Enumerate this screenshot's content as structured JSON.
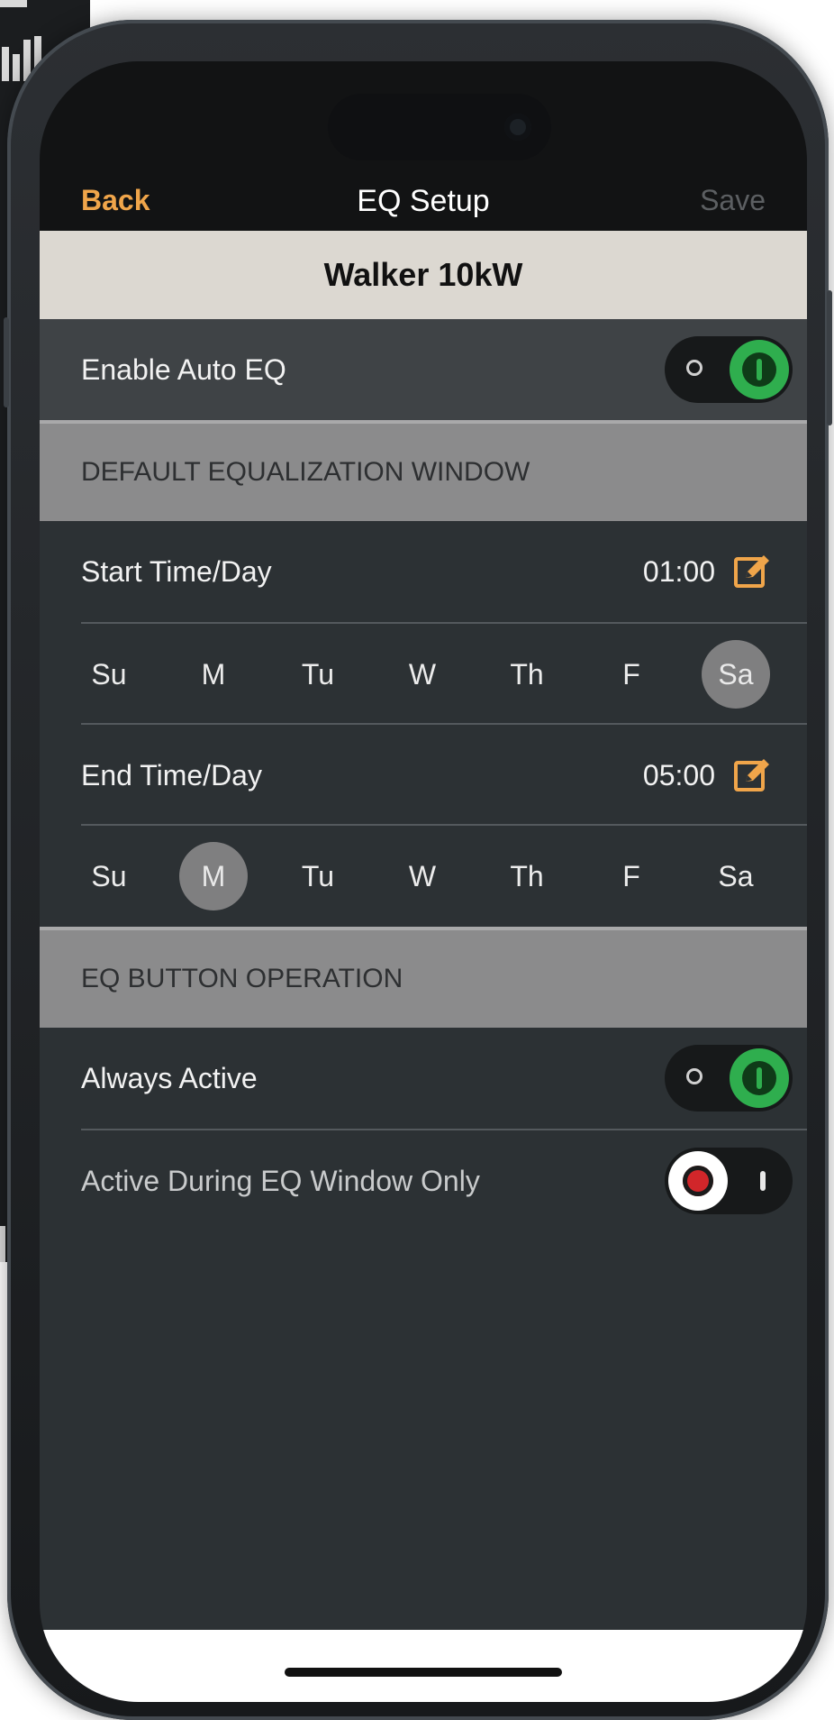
{
  "nav": {
    "back_label": "Back",
    "title": "EQ Setup",
    "save_label": "Save"
  },
  "device_name": "Walker 10kW",
  "enable_auto_eq": {
    "label": "Enable Auto EQ",
    "on": true
  },
  "sections": {
    "window_header": "DEFAULT EQUALIZATION WINDOW",
    "button_header": "EQ BUTTON OPERATION"
  },
  "start": {
    "label": "Start Time/Day",
    "time": "01:00",
    "days": [
      "Su",
      "M",
      "Tu",
      "W",
      "Th",
      "F",
      "Sa"
    ],
    "selected_day": "Sa"
  },
  "end": {
    "label": "End Time/Day",
    "time": "05:00",
    "days": [
      "Su",
      "M",
      "Tu",
      "W",
      "Th",
      "F",
      "Sa"
    ],
    "selected_day": "M"
  },
  "always_active": {
    "label": "Always Active",
    "on": true
  },
  "active_window_only": {
    "label": "Active During EQ Window Only",
    "on": false
  },
  "icons": {
    "edit": "edit-icon",
    "toggle_on": "toggle-on",
    "toggle_off": "toggle-off"
  },
  "colors": {
    "accent": "#f0a54a",
    "toggle_on": "#2fae4e",
    "toggle_off_dot": "#d1262a",
    "header_band": "#dcd8d1"
  }
}
